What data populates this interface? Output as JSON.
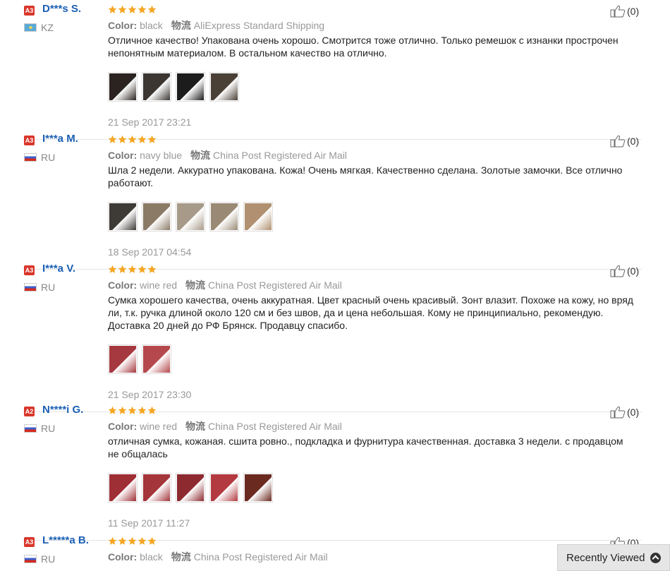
{
  "labels": {
    "color": "Color:",
    "shipping": "物流"
  },
  "reviews": [
    {
      "level": "A3",
      "user": "D***s S.",
      "country": "KZ",
      "flag": "kz",
      "color": "black",
      "shipping": "AliExpress Standard Shipping",
      "text": "Отличное качество! Упакована очень хорошо. Смотрится тоже отлично. Только ремешок с изнанки прострочен непонятным материалом. В остальном качество на отлично.",
      "date": "21 Sep 2017 23:21",
      "helpful": "(0)",
      "rating": 5,
      "photo_colors": [
        "#2a2320",
        "#3b3632",
        "#1c1c1c",
        "#4a4036"
      ]
    },
    {
      "level": "A3",
      "user": "I***a M.",
      "country": "RU",
      "flag": "ru",
      "color": "navy blue",
      "shipping": "China Post Registered Air Mail",
      "text": "Шла 2 недели. Аккуратно упакована. Кожа! Очень мягкая. Качественно сделана. Золотые замочки. Все отлично работают.",
      "date": "18 Sep 2017 04:54",
      "helpful": "(0)",
      "rating": 5,
      "photo_colors": [
        "#3e3a35",
        "#8b7a66",
        "#a79a88",
        "#9a8a75",
        "#b09070"
      ]
    },
    {
      "level": "A3",
      "user": "I***a V.",
      "country": "RU",
      "flag": "ru",
      "color": "wine red",
      "shipping": "China Post Registered Air Mail",
      "text": "Сумка хорошего качества, очень аккуратная. Цвет красный очень красивый. Зонт влазит. Похоже на кожу, но вряд ли, т.к. ручка длиной около 120 см и без швов, да и цена небольшая. Кому не принципиально, рекомендую. Доставка 20 дней до РФ Брянск. Продавцу спасибо.",
      "date": "21 Sep 2017 23:30",
      "helpful": "(0)",
      "rating": 5,
      "photo_colors": [
        "#a5393f",
        "#b5484c"
      ]
    },
    {
      "level": "A2",
      "user": "N****i G.",
      "country": "RU",
      "flag": "ru",
      "color": "wine red",
      "shipping": "China Post Registered Air Mail",
      "text": "отличная сумка, кожаная. сшита ровно., подкладка и фурнитура качественная. доставка 3 недели. с продавцом не общалась",
      "date": "11 Sep 2017 11:27",
      "helpful": "(0)",
      "rating": 5,
      "photo_colors": [
        "#9e2f35",
        "#a3353b",
        "#8c2a30",
        "#b23a40",
        "#6b2a20"
      ]
    },
    {
      "level": "A3",
      "user": "L*****a B.",
      "country": "RU",
      "flag": "ru",
      "color": "black",
      "shipping": "China Post Registered Air Mail",
      "text": "",
      "date": "",
      "helpful": "(0)",
      "rating": 5,
      "photo_colors": []
    }
  ],
  "recently_viewed": {
    "label": "Recently Viewed"
  },
  "colors": {
    "username": "#1a5fb4",
    "badge": "#d9362b",
    "star": "#f5a623"
  }
}
